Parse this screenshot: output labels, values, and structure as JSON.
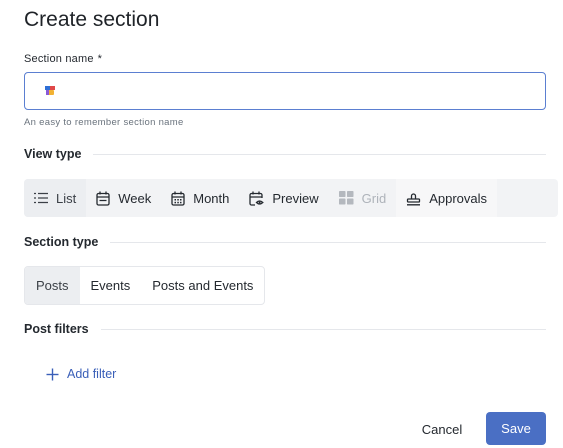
{
  "page": {
    "title": "Create section"
  },
  "section_name": {
    "label": "Section name",
    "required_marker": "*",
    "value": "",
    "emoji_icon": "flag-emoji-icon",
    "hint": "An easy to remember section name"
  },
  "view_type": {
    "heading": "View type",
    "options": [
      {
        "label": "List",
        "icon": "list-icon",
        "selected": true,
        "disabled": false
      },
      {
        "label": "Week",
        "icon": "calendar-week-icon",
        "selected": false,
        "disabled": false
      },
      {
        "label": "Month",
        "icon": "calendar-month-icon",
        "selected": false,
        "disabled": false
      },
      {
        "label": "Preview",
        "icon": "calendar-eye-icon",
        "selected": false,
        "disabled": false
      },
      {
        "label": "Grid",
        "icon": "grid-icon",
        "selected": false,
        "disabled": true
      },
      {
        "label": "Approvals",
        "icon": "stamp-icon",
        "selected": false,
        "disabled": false
      }
    ]
  },
  "section_type": {
    "heading": "Section type",
    "options": [
      {
        "label": "Posts",
        "selected": true
      },
      {
        "label": "Events",
        "selected": false
      },
      {
        "label": "Posts and Events",
        "selected": false
      }
    ]
  },
  "post_filters": {
    "heading": "Post filters",
    "add_label": "Add filter"
  },
  "footer": {
    "cancel_label": "Cancel",
    "save_label": "Save"
  },
  "colors": {
    "accent": "#4a6fc4",
    "link": "#3a5fb8",
    "selected_bg": "#eceef1"
  }
}
